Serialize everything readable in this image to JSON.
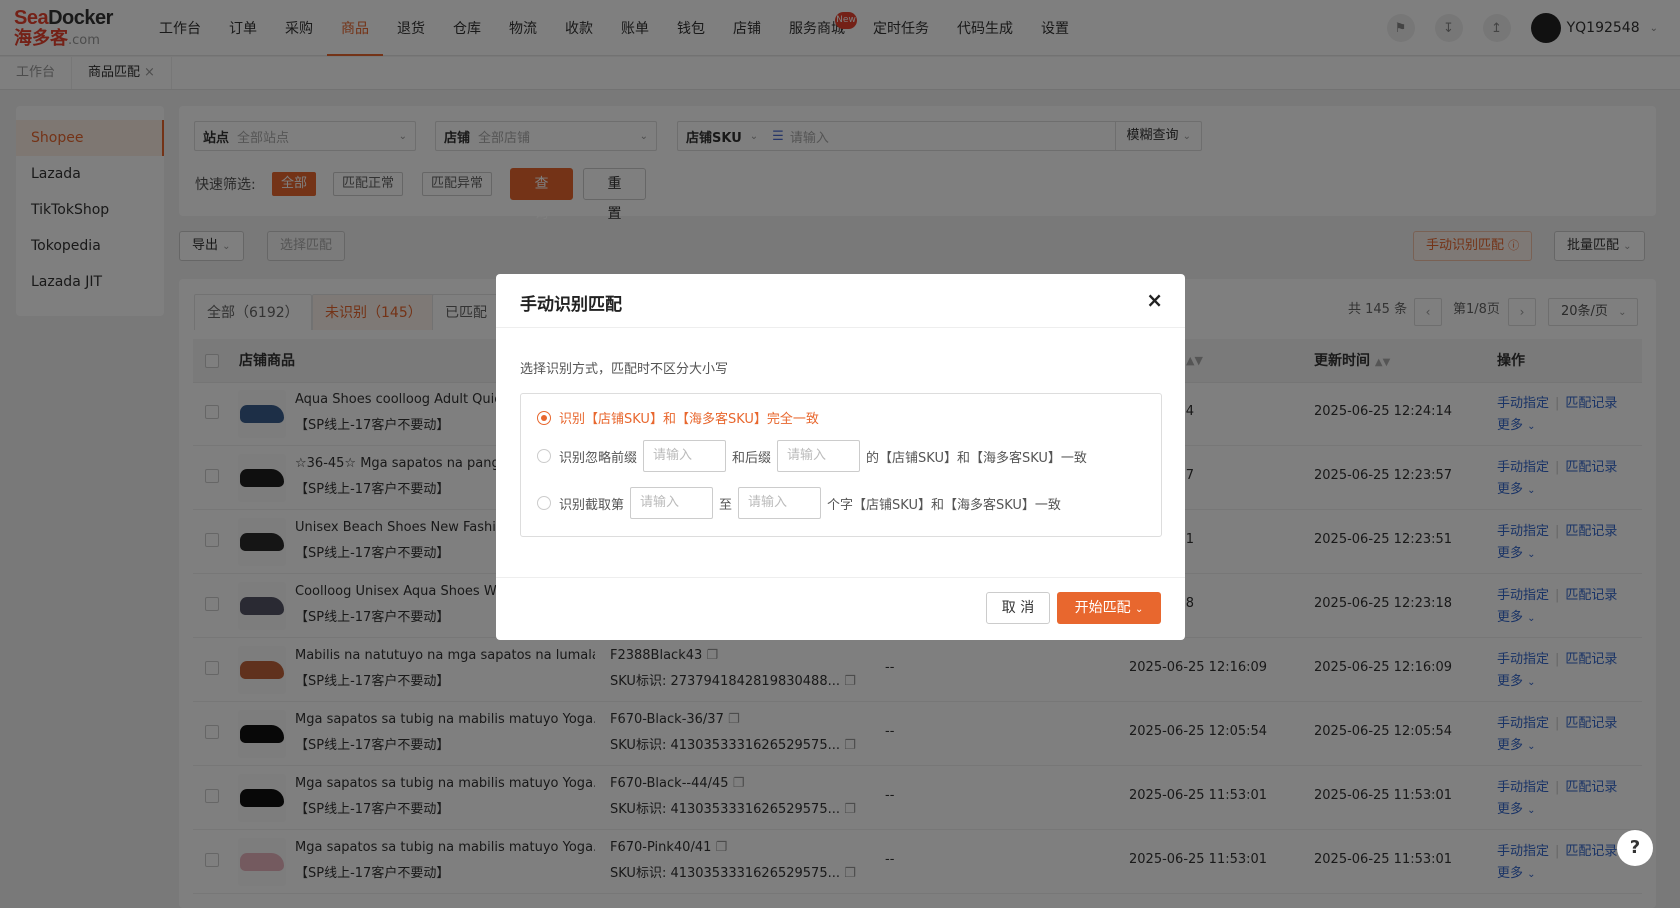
{
  "logo": {
    "brand_a": "Sea",
    "brand_b": "Docker",
    "cn": "海多客",
    "domain": ".com"
  },
  "nav": [
    "工作台",
    "订单",
    "采购",
    "商品",
    "退货",
    "仓库",
    "物流",
    "收款",
    "账单",
    "钱包",
    "店铺",
    "服务商城",
    "定时任务",
    "代码生成",
    "设置"
  ],
  "nav_active": "商品",
  "nav_badge": "New",
  "user": {
    "name": "YQ192548"
  },
  "tabs": [
    {
      "label": "工作台"
    },
    {
      "label": "商品匹配",
      "close": "×"
    }
  ],
  "sidebar": [
    "Shopee",
    "Lazada",
    "TikTokShop",
    "Tokopedia",
    "Lazada JIT"
  ],
  "filters": {
    "site_label": "站点",
    "site_value": "全部站点",
    "shop_label": "店铺",
    "shop_value": "全部店铺",
    "sku_label": "店铺SKU",
    "sku_placeholder": "请输入",
    "mode": "模糊查询",
    "quick_label": "快速筛选:",
    "chips": [
      "全部",
      "匹配正常",
      "匹配异常"
    ],
    "query": "查 询",
    "reset": "重 置"
  },
  "toolbar": {
    "export": "导出",
    "select_match": "选择匹配",
    "manual": "手动识别匹配",
    "batch": "批量匹配"
  },
  "table_tabs": [
    "全部（6192）",
    "未识别（145）",
    "已匹配（"
  ],
  "pager": {
    "total": "共 145 条",
    "page": "第1/8页",
    "size": "20条/页"
  },
  "columns": {
    "product": "店铺商品",
    "updated": "更新时间",
    "ops": "操作"
  },
  "rows": [
    {
      "name": "Aqua Shoes coolloog Adult Quick",
      "shop": "【SP线上-17客户不要动】",
      "sku": "",
      "skuid": "",
      "match": "",
      "created": "25 12:24:14",
      "updated": "2025-06-25 12:24:14",
      "color": "#3a5f8f"
    },
    {
      "name": "☆36-45☆ Mga sapatos na pang-t",
      "shop": "【SP线上-17客户不要动】",
      "sku": "",
      "skuid": "",
      "match": "",
      "created": "25 12:23:57",
      "updated": "2025-06-25 12:23:57",
      "color": "#1e1e1e"
    },
    {
      "name": "Unisex Beach Shoes New Fashic",
      "shop": "【SP线上-17客户不要动】",
      "sku": "",
      "skuid": "",
      "match": "",
      "created": "25 12:23:51",
      "updated": "2025-06-25 12:23:51",
      "color": "#2a2a2a"
    },
    {
      "name": "Coolloog Unisex Aqua Shoes Wa",
      "shop": "【SP线上-17客户不要动】",
      "sku": "",
      "skuid": "",
      "match": "",
      "created": "25 12:23:18",
      "updated": "2025-06-25 12:23:18",
      "color": "#555566"
    },
    {
      "name": "Mabilis na natutuyo na mga sapatos na lumala...",
      "shop": "【SP线上-17客户不要动】",
      "sku": "F2388Black43",
      "skuid": "SKU标识:  2737941842819830488...",
      "match": "--",
      "created": "2025-06-25 12:16:09",
      "updated": "2025-06-25 12:16:09",
      "color": "#c0633a"
    },
    {
      "name": "Mga sapatos sa tubig na mabilis matuyo Yoga...",
      "shop": "【SP线上-17客户不要动】",
      "sku": "F670-Black-36/37",
      "skuid": "SKU标识:  4130353331626529575...",
      "match": "--",
      "created": "2025-06-25 12:05:54",
      "updated": "2025-06-25 12:05:54",
      "color": "#111111"
    },
    {
      "name": "Mga sapatos sa tubig na mabilis matuyo Yoga...",
      "shop": "【SP线上-17客户不要动】",
      "sku": "F670-Black--44/45",
      "skuid": "SKU标识:  4130353331626529575...",
      "match": "--",
      "created": "2025-06-25 11:53:01",
      "updated": "2025-06-25 11:53:01",
      "color": "#111111"
    },
    {
      "name": "Mga sapatos sa tubig na mabilis matuyo Yoga...",
      "shop": "【SP线上-17客户不要动】",
      "sku": "F670-Pink40/41",
      "skuid": "SKU标识:  4130353331626529575...",
      "match": "--",
      "created": "2025-06-25 11:53:01",
      "updated": "2025-06-25 11:53:01",
      "color": "#e8b4bf"
    }
  ],
  "row_ops": {
    "assign": "手动指定",
    "log": "匹配记录",
    "more": "更多"
  },
  "modal": {
    "title": "手动识别匹配",
    "close": "×",
    "hint": "选择识别方式，匹配时不区分大小写",
    "opt1": "识别【店铺SKU】和【海多客SKU】完全一致",
    "opt2_a": "识别忽略前缀",
    "opt2_b": "和后缀",
    "opt2_c": "的【店铺SKU】和【海多客SKU】一致",
    "opt3_a": "识别截取第",
    "opt3_b": "至",
    "opt3_c": "个字【店铺SKU】和【海多客SKU】一致",
    "input_placeholder": "请输入",
    "cancel": "取 消",
    "start": "开始匹配"
  },
  "help": "?",
  "colors": {
    "accent": "#e8672e",
    "link": "#3366cc"
  }
}
